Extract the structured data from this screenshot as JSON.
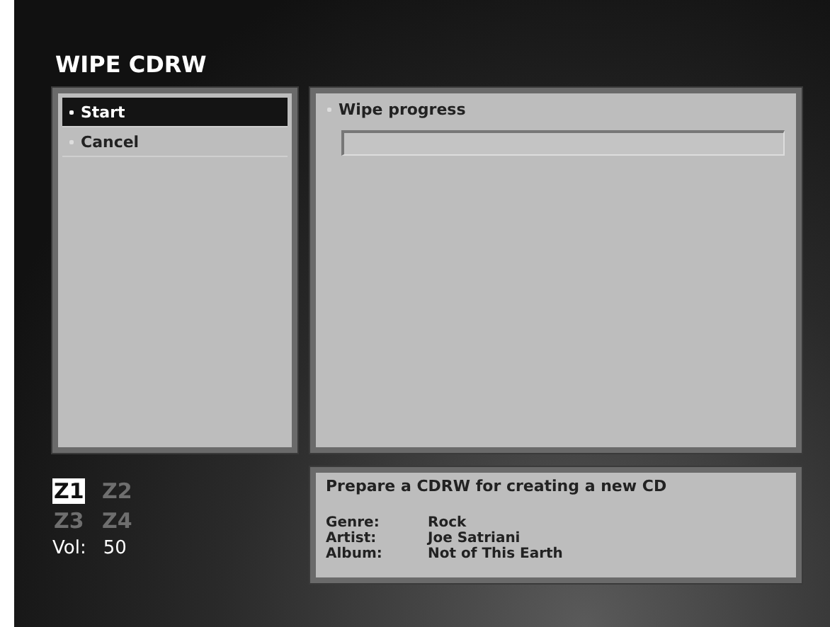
{
  "title": "WIPE CDRW",
  "menu": [
    {
      "label": "Start",
      "selected": true
    },
    {
      "label": "Cancel",
      "selected": false
    }
  ],
  "progress": {
    "label": "Wipe progress",
    "level": 0
  },
  "zones": [
    {
      "label": "Z1",
      "selected": true
    },
    {
      "label": "Z2",
      "selected": false
    },
    {
      "label": "Z3",
      "selected": false
    },
    {
      "label": "Z4",
      "selected": false
    }
  ],
  "volume": {
    "label": "Vol:",
    "value": "50"
  },
  "info": {
    "description": "Prepare a CDRW for creating a new CD",
    "fields": [
      {
        "label": "Genre:",
        "value": "Rock"
      },
      {
        "label": "Artist:",
        "value": "Joe Satriani"
      },
      {
        "label": "Album:",
        "value": "Not of This Earth"
      }
    ]
  }
}
